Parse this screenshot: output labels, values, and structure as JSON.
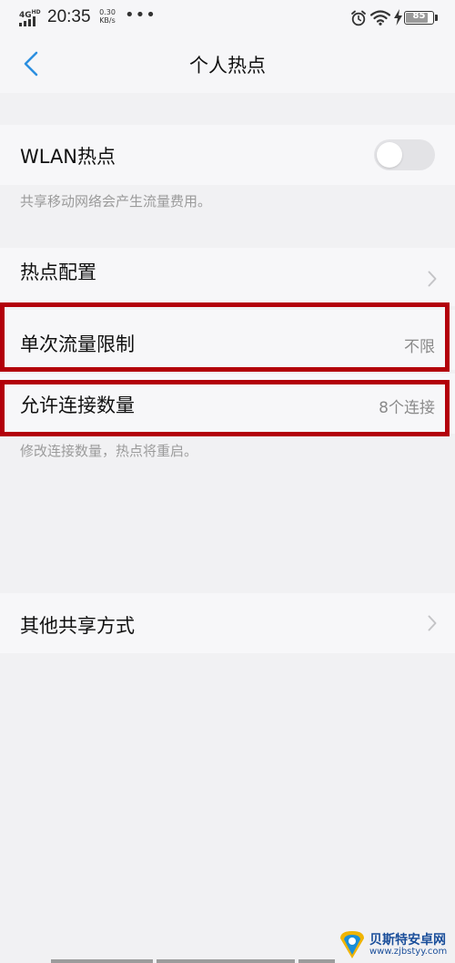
{
  "status_bar": {
    "network": "4G",
    "hd": "HD",
    "time": "20:35",
    "speed_value": "0.30",
    "speed_unit": "KB/s",
    "more": "•••",
    "battery": "85"
  },
  "header": {
    "title": "个人热点"
  },
  "wlan_hotspot": {
    "label": "WLAN热点",
    "enabled": false,
    "note": "共享移动网络会产生流量费用。"
  },
  "hotspot_config": {
    "label": "热点配置"
  },
  "data_limit": {
    "label": "单次流量限制",
    "value": "不限"
  },
  "connections": {
    "label": "允许连接数量",
    "value": "8个连接",
    "note": "修改连接数量，热点将重启。"
  },
  "other_sharing": {
    "label": "其他共享方式"
  },
  "colors": {
    "accent": "#2c8fe0",
    "highlight_border": "#b3000a",
    "background": "#f1f1f3",
    "row_background": "#f7f7f9"
  },
  "watermark": {
    "name": "贝斯特安卓网",
    "url": "www.zjbstyy.com"
  }
}
